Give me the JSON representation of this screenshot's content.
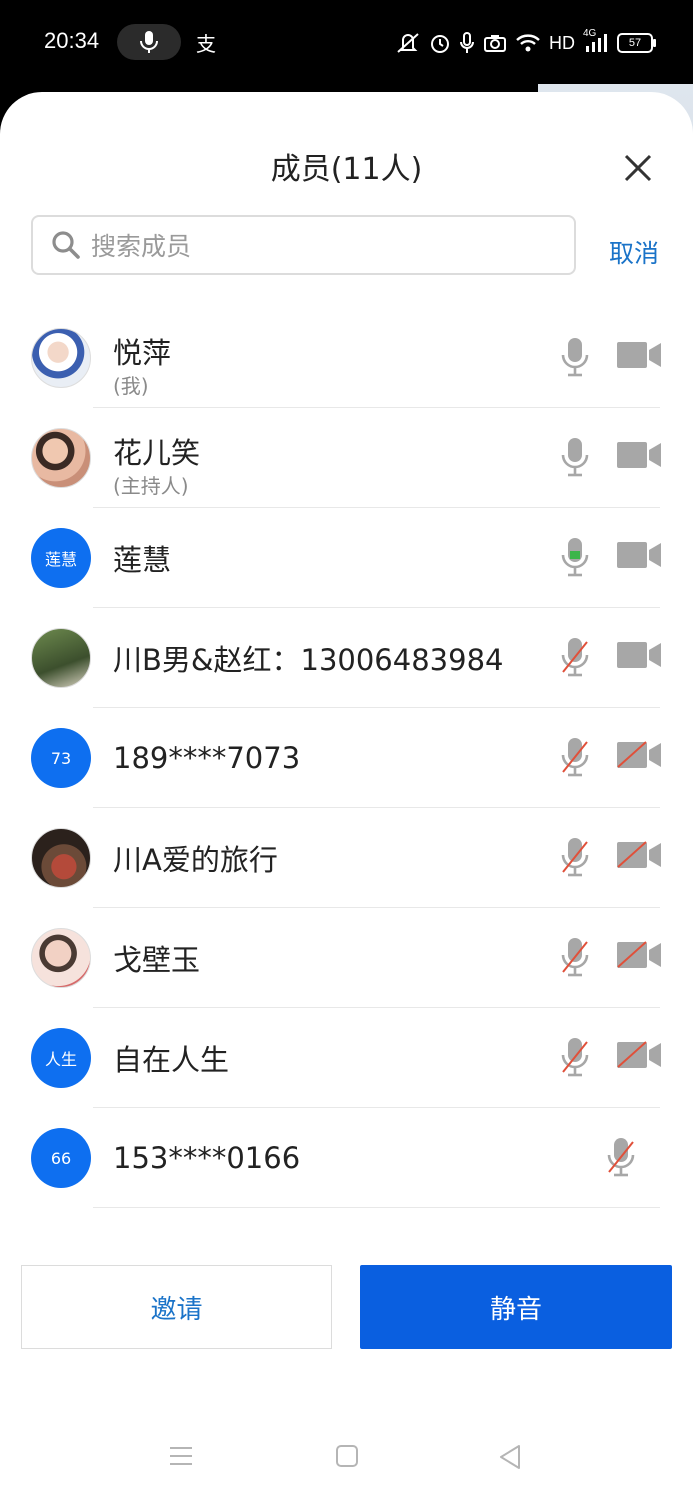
{
  "status_bar": {
    "time": "20:34",
    "network_label": "HD",
    "signal_label": "4G",
    "battery": "57",
    "app_icon_glyph": "支",
    "icons": [
      "mic-pill-icon",
      "alipay-icon",
      "mute-vibrate-icon",
      "alarm-icon",
      "mic-icon",
      "camera-icon",
      "wifi-icon",
      "signal-icon",
      "battery-icon"
    ]
  },
  "header": {
    "title": "成员(11人)",
    "close_icon": "close-icon"
  },
  "search": {
    "placeholder": "搜索成员",
    "value": "",
    "cancel_label": "取消"
  },
  "members": [
    {
      "name": "悦萍",
      "tag": "(我)",
      "avatar": "photo",
      "mic": "on",
      "camera": "off-gray"
    },
    {
      "name": "花儿笑",
      "tag": "(主持人)",
      "avatar": "photo",
      "mic": "on",
      "camera": "off-gray"
    },
    {
      "name": "莲慧",
      "tag": "",
      "avatar": "莲慧",
      "mic": "speaking",
      "camera": "off-gray"
    },
    {
      "name": "川B男&赵红：13006483984",
      "tag": "",
      "avatar": "photo",
      "mic": "muted",
      "camera": "off-gray"
    },
    {
      "name": "189****7073",
      "tag": "",
      "avatar": "73",
      "mic": "muted",
      "camera": "disabled"
    },
    {
      "name": "川A爱的旅行",
      "tag": "",
      "avatar": "photo",
      "mic": "muted",
      "camera": "disabled"
    },
    {
      "name": "戈壁玉",
      "tag": "",
      "avatar": "photo",
      "mic": "muted",
      "camera": "disabled"
    },
    {
      "name": "自在人生",
      "tag": "",
      "avatar": "人生",
      "mic": "muted",
      "camera": "disabled"
    },
    {
      "name": "153****0166",
      "tag": "",
      "avatar": "66",
      "mic": "muted",
      "camera": "none"
    }
  ],
  "actions": {
    "invite_label": "邀请",
    "mute_all_label": "静音"
  },
  "nav": {
    "icons": [
      "menu-nav-icon",
      "home-nav-icon",
      "back-nav-icon"
    ]
  },
  "colors": {
    "accent": "#0a5fe0",
    "link": "#1a73c8",
    "speaking": "#3bb54a",
    "muted_slash": "#e0503a",
    "icon_gray": "#a7a7a7"
  }
}
